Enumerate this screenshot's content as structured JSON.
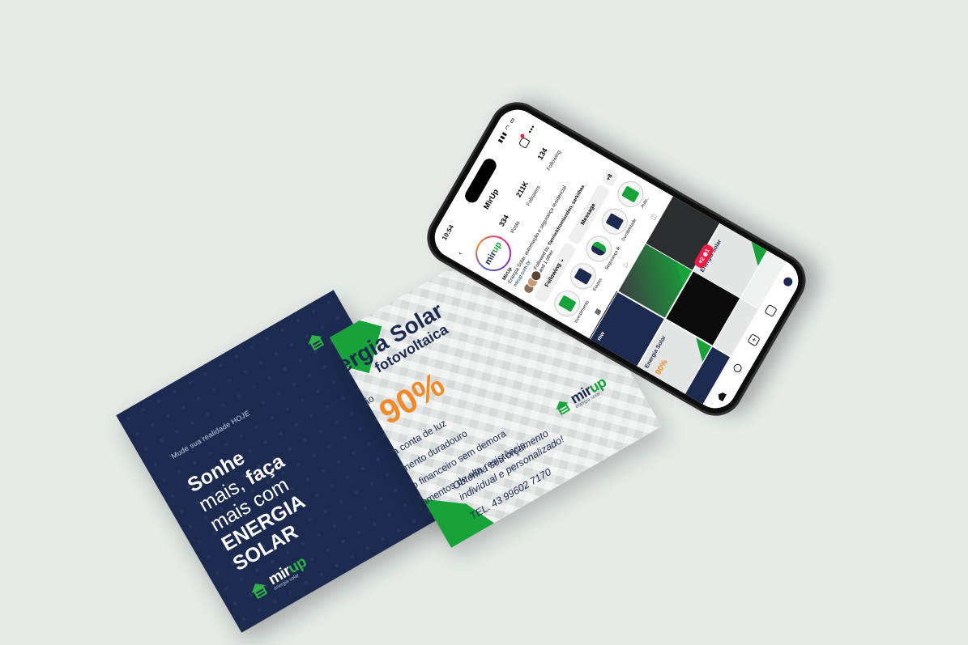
{
  "navy_card": {
    "tagline": "Mude sua realidade HOJE",
    "line1": "Sonhe",
    "line2_a": "mais, ",
    "line2_b": "faça",
    "line3": "mais com",
    "line4": "ENERGIA",
    "line5": "SOLAR",
    "brand_a": "mir",
    "brand_b": "up",
    "brand_sub": "energia solar"
  },
  "gray_card": {
    "title": "ergia Solar",
    "subtitle": "fotovoltaica",
    "small": "ão",
    "percent": "90%",
    "list": [
      "na conta de luz",
      "timento duradouro",
      "no financeiro sem demora",
      "pamentos de alta resistência"
    ],
    "cta_1": "Obtenha seu orçamento",
    "cta_2": "individual e personalizado!",
    "tel": "TEL. 43 99602 7170",
    "brand_a": "mir",
    "brand_b": "up",
    "brand_sub": "energia solar"
  },
  "phone": {
    "status_time": "10:54",
    "status_icons": "▮▮▮ ◠ ▭",
    "username": "MirUp",
    "avatar_a": "mir",
    "avatar_b": "up",
    "stats": [
      {
        "n": "334",
        "l": "Posts"
      },
      {
        "n": "211K",
        "l": "Followers"
      },
      {
        "n": "134",
        "l": "Following"
      }
    ],
    "bio_name": "MirUp",
    "bio_text": "Energia Solar, automação e segurança residencial",
    "bio_link": "mirup.com.br",
    "followed_prefix": "Followed by ",
    "followed_names": "Yannickfromlondon, sarkithas_",
    "followed_suffix": "and 1 other",
    "btn_following": "Following ⌄",
    "btn_message": "Message",
    "btn_add": "+8",
    "highlights": [
      "Investimento",
      "Etapas",
      "Segurança R..",
      "Durabilidade",
      "Auto.."
    ],
    "grid_text": {
      "title_a": "Energia Solar",
      "title_b": "fotovoltaica",
      "pct": "90%",
      "brand_a": "mir",
      "brand_b": "up",
      "mw": "mw"
    },
    "notif": "♥2  ◉1"
  },
  "colors": {
    "navy": "#1b2a4e",
    "green": "#17a33a",
    "orange": "#ef8b2b",
    "background": "#e6ebe8"
  }
}
